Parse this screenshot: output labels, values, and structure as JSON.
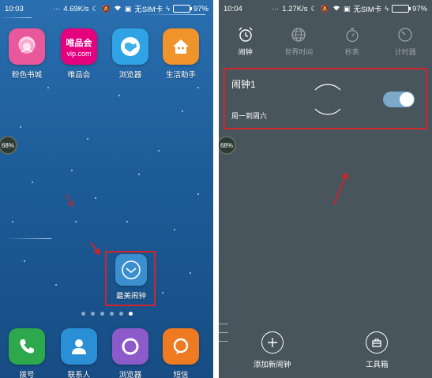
{
  "left_phone": {
    "status": {
      "time": "10:03",
      "network_speed": "4.69K/s",
      "sim": "无SIM卡",
      "battery": "97%",
      "battery_level": 0.97
    },
    "apps_top": [
      {
        "label": "粉色书城",
        "icon": "book-flower-icon",
        "color": "#e8589b"
      },
      {
        "label": "唯品会",
        "icon": "vip-logo-icon",
        "color": "#e5007e",
        "icon_text_line1": "唯品会",
        "icon_text_line2": "vip.com"
      },
      {
        "label": "浏览器",
        "icon": "globe-icon",
        "color": "#2fa3e4"
      },
      {
        "label": "生活助手",
        "icon": "house-icon",
        "color": "#f0932b"
      }
    ],
    "floating_badge": "68%",
    "highlighted_app": {
      "label": "最美闹钟",
      "icon": "clock-icon"
    },
    "dock": [
      {
        "label": "拨号",
        "icon": "phone-icon",
        "color": "#2ea84c"
      },
      {
        "label": "联系人",
        "icon": "contact-icon",
        "color": "#2b8fd6"
      },
      {
        "label": "浏览器",
        "icon": "browser-ring-icon",
        "color": "#8c5bc9"
      },
      {
        "label": "短信",
        "icon": "message-icon",
        "color": "#ee7b22"
      }
    ],
    "page_count": 6,
    "active_page_index": 5
  },
  "right_phone": {
    "status": {
      "time": "10:04",
      "network_speed": "1.27K/s",
      "sim": "无SIM卡",
      "battery": "97%",
      "battery_level": 0.97
    },
    "tabs": [
      {
        "label": "闹钟",
        "icon": "alarm-clock-icon",
        "active": true
      },
      {
        "label": "世界时间",
        "icon": "world-globe-icon",
        "active": false
      },
      {
        "label": "秒表",
        "icon": "stopwatch-icon",
        "active": false
      },
      {
        "label": "计时器",
        "icon": "timer-icon",
        "active": false
      }
    ],
    "alarm": {
      "name": "闹钟1",
      "repeat": "周一到周六",
      "enabled": true
    },
    "floating_badge": "68%",
    "actions": [
      {
        "label": "添加新闹钟",
        "icon": "plus-circle-icon"
      },
      {
        "label": "工具箱",
        "icon": "toolbox-icon"
      }
    ]
  },
  "colors": {
    "highlight": "#d0262b",
    "toggle_on": "#7aa9c9",
    "battery": "#6ddc3c"
  }
}
